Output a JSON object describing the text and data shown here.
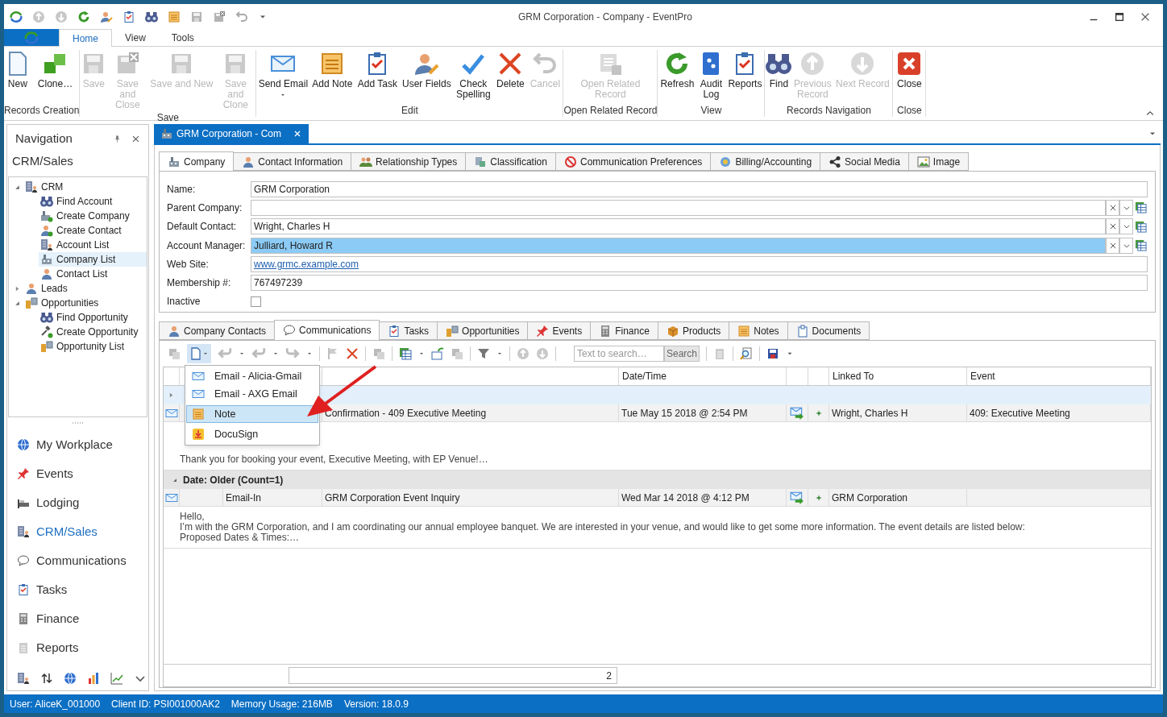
{
  "window": {
    "title": "GRM Corporation - Company - EventPro"
  },
  "ribbon_tabs": [
    {
      "label": "Home",
      "selected": true
    },
    {
      "label": "View",
      "selected": false
    },
    {
      "label": "Tools",
      "selected": false
    }
  ],
  "ribbon_groups": [
    {
      "label": "Records Creation",
      "buttons": [
        {
          "label": "New",
          "disabled": false,
          "kind": "plain"
        },
        {
          "label": "Clone…",
          "disabled": false,
          "kind": "plain"
        }
      ]
    },
    {
      "label": "Save",
      "buttons": [
        {
          "label": "Save",
          "disabled": true,
          "kind": "plain"
        },
        {
          "label": "Save and Close",
          "disabled": true,
          "kind": "plain"
        },
        {
          "label": "Save and New",
          "disabled": true,
          "kind": "plain"
        },
        {
          "label": "Save and Clone",
          "disabled": true,
          "kind": "plain"
        }
      ]
    },
    {
      "label": "Edit",
      "buttons": [
        {
          "label": "Send Email",
          "disabled": false,
          "kind": "dropdown"
        },
        {
          "label": "Add Note",
          "disabled": false,
          "kind": "plain"
        },
        {
          "label": "Add Task",
          "disabled": false,
          "kind": "plain"
        },
        {
          "label": "User Fields",
          "disabled": false,
          "kind": "plain"
        },
        {
          "label": "Check Spelling",
          "disabled": false,
          "kind": "plain"
        },
        {
          "label": "Delete",
          "disabled": false,
          "kind": "plain"
        },
        {
          "label": "Cancel",
          "disabled": true,
          "kind": "plain"
        }
      ]
    },
    {
      "label": "Open Related Record",
      "buttons": [
        {
          "label": "Open Related Record",
          "disabled": true,
          "kind": "plain"
        }
      ]
    },
    {
      "label": "View",
      "buttons": [
        {
          "label": "Refresh",
          "disabled": false,
          "kind": "plain"
        },
        {
          "label": "Audit Log",
          "disabled": false,
          "kind": "plain"
        },
        {
          "label": "Reports",
          "disabled": false,
          "kind": "plain"
        }
      ]
    },
    {
      "label": "Records Navigation",
      "buttons": [
        {
          "label": "Find",
          "disabled": false,
          "kind": "plain"
        },
        {
          "label": "Previous Record",
          "disabled": true,
          "kind": "plain"
        },
        {
          "label": "Next Record",
          "disabled": true,
          "kind": "plain"
        }
      ]
    },
    {
      "label": "Close",
      "buttons": [
        {
          "label": "Close",
          "disabled": false,
          "kind": "plain"
        }
      ]
    }
  ],
  "navigation": {
    "title": "Navigation",
    "section": "CRM/Sales",
    "tree": [
      {
        "label": "CRM",
        "expanded": true,
        "selected": false,
        "children": [
          {
            "label": "Find Account",
            "selected": false
          },
          {
            "label": "Create Company",
            "selected": false
          },
          {
            "label": "Create Contact",
            "selected": false
          },
          {
            "label": "Account List",
            "selected": false
          },
          {
            "label": "Company List",
            "selected": true
          },
          {
            "label": "Contact List",
            "selected": false
          }
        ]
      },
      {
        "label": "Leads",
        "expanded": false,
        "selected": false
      },
      {
        "label": "Opportunities",
        "expanded": true,
        "selected": false,
        "children": [
          {
            "label": "Find Opportunity",
            "selected": false
          },
          {
            "label": "Create Opportunity",
            "selected": false
          },
          {
            "label": "Opportunity List",
            "selected": false
          }
        ]
      }
    ],
    "modules": [
      {
        "label": "My Workplace",
        "selected": false
      },
      {
        "label": "Events",
        "selected": false
      },
      {
        "label": "Lodging",
        "selected": false
      },
      {
        "label": "CRM/Sales",
        "selected": true
      },
      {
        "label": "Communications",
        "selected": false
      },
      {
        "label": "Tasks",
        "selected": false
      },
      {
        "label": "Finance",
        "selected": false
      },
      {
        "label": "Reports",
        "selected": false
      }
    ]
  },
  "document_tab": {
    "label": "GRM Corporation - Com"
  },
  "form_tabs": [
    {
      "label": "Company",
      "selected": true
    },
    {
      "label": "Contact Information",
      "selected": false
    },
    {
      "label": "Relationship Types",
      "selected": false
    },
    {
      "label": "Classification",
      "selected": false
    },
    {
      "label": "Communication Preferences",
      "selected": false
    },
    {
      "label": "Billing/Accounting",
      "selected": false
    },
    {
      "label": "Social Media",
      "selected": false
    },
    {
      "label": "Image",
      "selected": false
    }
  ],
  "fields": [
    {
      "label": "Name:",
      "kind": "text",
      "value": "GRM Corporation"
    },
    {
      "label": "Parent Company:",
      "kind": "lookup"
    },
    {
      "label": "Default Contact:",
      "kind": "lookup",
      "value": "Wright, Charles H"
    },
    {
      "label": "Account Manager:",
      "kind": "lookup",
      "value": "Julliard, Howard R",
      "focused": true
    },
    {
      "label": "Web Site:",
      "kind": "link",
      "value": "www.grmc.example.com"
    },
    {
      "label": "Membership #:",
      "kind": "text",
      "value": "767497239"
    },
    {
      "label": "Inactive",
      "kind": "checkbox",
      "checked": false
    }
  ],
  "sub_tabs": [
    {
      "label": "Company Contacts",
      "selected": false
    },
    {
      "label": "Communications",
      "selected": true
    },
    {
      "label": "Tasks",
      "selected": false
    },
    {
      "label": "Opportunities",
      "selected": false
    },
    {
      "label": "Events",
      "selected": false
    },
    {
      "label": "Finance",
      "selected": false
    },
    {
      "label": "Products",
      "selected": false
    },
    {
      "label": "Notes",
      "selected": false
    },
    {
      "label": "Documents",
      "selected": false
    }
  ],
  "search": {
    "placeholder": "Text to search…",
    "button": "Search"
  },
  "grid": {
    "columns": [
      "Date/Time",
      "Linked To",
      "Event"
    ],
    "groups": [
      {
        "rows": [
          {
            "subject": "Confirmation - 409 Executive Meeting",
            "date_time": "Tue May 15 2018 @ 2:54 PM",
            "linked_to": "Wright, Charles H",
            "event": "409: Executive Meeting",
            "preview": "Thank you for booking your event, Executive Meeting, with EP Venue!…"
          }
        ]
      },
      {
        "label": "Date: Older (Count=1)",
        "rows": [
          {
            "type": "Email-In",
            "subject": "GRM Corporation Event Inquiry",
            "date_time": "Wed Mar 14 2018 @ 4:12 PM",
            "linked_to": "GRM Corporation",
            "preview": "Hello,\nI’m with the GRM Corporation, and I am coordinating our annual employee banquet. We are interested in your venue, and would like to get some more information. The event details are listed below:\nProposed Dates & Times:…"
          }
        ]
      }
    ],
    "count": "2"
  },
  "new_menu": [
    {
      "label": "Email - Alicia-Gmail",
      "selected": false
    },
    {
      "label": "Email - AXG Email",
      "selected": false
    },
    {
      "label": "Note",
      "selected": true
    },
    {
      "label": "DocuSign",
      "selected": false
    }
  ],
  "status_bar": [
    "User: AliceK_001000",
    "Client ID: PSI001000AK2",
    "Memory Usage: 216MB",
    "Version: 18.0.9"
  ]
}
